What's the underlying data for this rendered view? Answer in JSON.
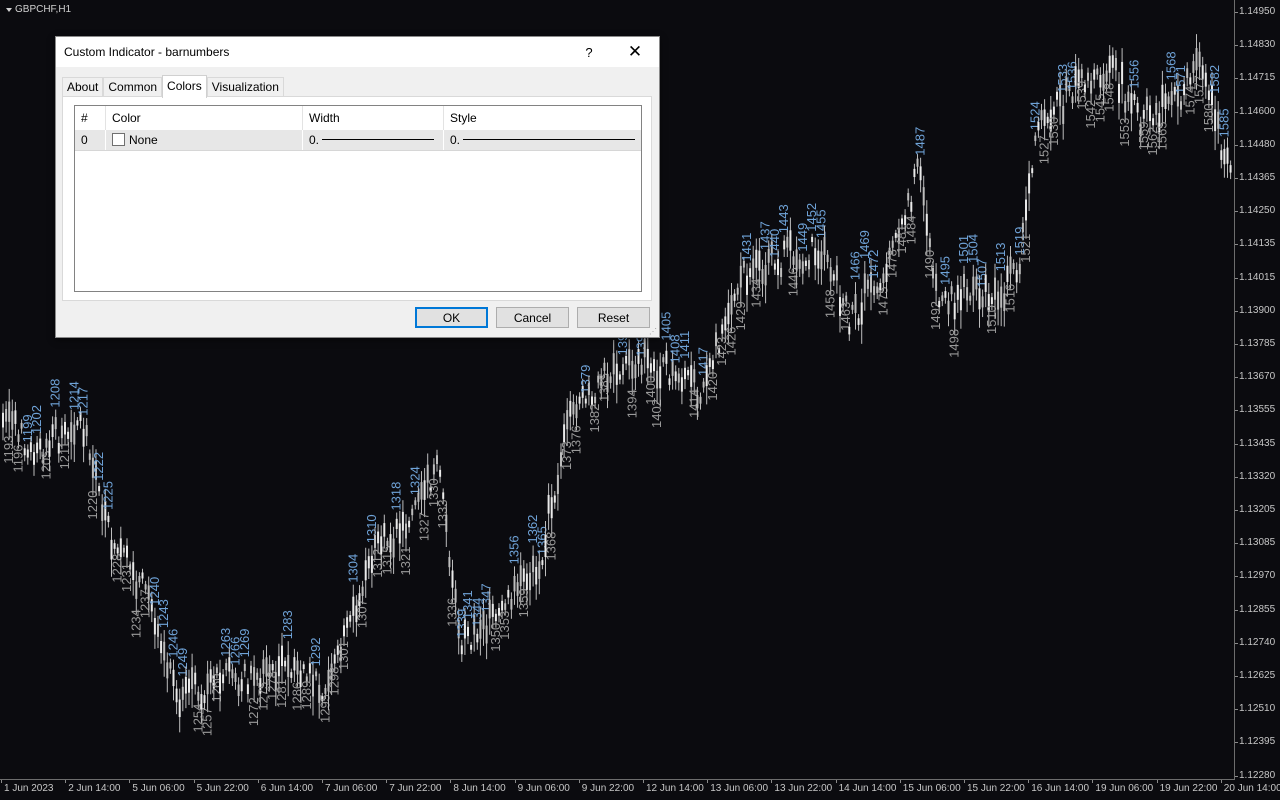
{
  "chart": {
    "symbol": "GBPCHF,H1",
    "price_ticks": [
      "1.14950",
      "1.14830",
      "1.14715",
      "1.14600",
      "1.14480",
      "1.14365",
      "1.14250",
      "1.14135",
      "1.14015",
      "1.13900",
      "1.13785",
      "1.13670",
      "1.13555",
      "1.13435",
      "1.13320",
      "1.13205",
      "1.13085",
      "1.12970",
      "1.12855",
      "1.12740",
      "1.12625",
      "1.12510",
      "1.12395",
      "1.12280"
    ],
    "time_ticks": [
      "1 Jun 2023",
      "2 Jun 14:00",
      "5 Jun 06:00",
      "5 Jun 22:00",
      "6 Jun 14:00",
      "7 Jun 06:00",
      "7 Jun 22:00",
      "8 Jun 14:00",
      "9 Jun 06:00",
      "9 Jun 22:00",
      "12 Jun 14:00",
      "13 Jun 06:00",
      "13 Jun 22:00",
      "14 Jun 14:00",
      "15 Jun 06:00",
      "15 Jun 22:00",
      "16 Jun 14:00",
      "19 Jun 06:00",
      "19 Jun 22:00",
      "20 Jun 14:00"
    ],
    "colors": {
      "background": "#0b0b0f",
      "candle": "#bdbdbd",
      "label_up": "#6fa3d8",
      "label_down": "#9a9a9a"
    }
  },
  "dialog": {
    "title": "Custom Indicator - barnumbers",
    "help_label": "?",
    "close_label": "✕",
    "tabs": [
      "About",
      "Common",
      "Colors",
      "Visualization"
    ],
    "active_tab": "Colors",
    "grid": {
      "headers": [
        "#",
        "Color",
        "Width",
        "Style"
      ],
      "rows": [
        {
          "index": "0",
          "color": "None",
          "width": "0.",
          "style": "0."
        }
      ]
    },
    "buttons": {
      "ok": "OK",
      "cancel": "Cancel",
      "reset": "Reset"
    }
  }
}
